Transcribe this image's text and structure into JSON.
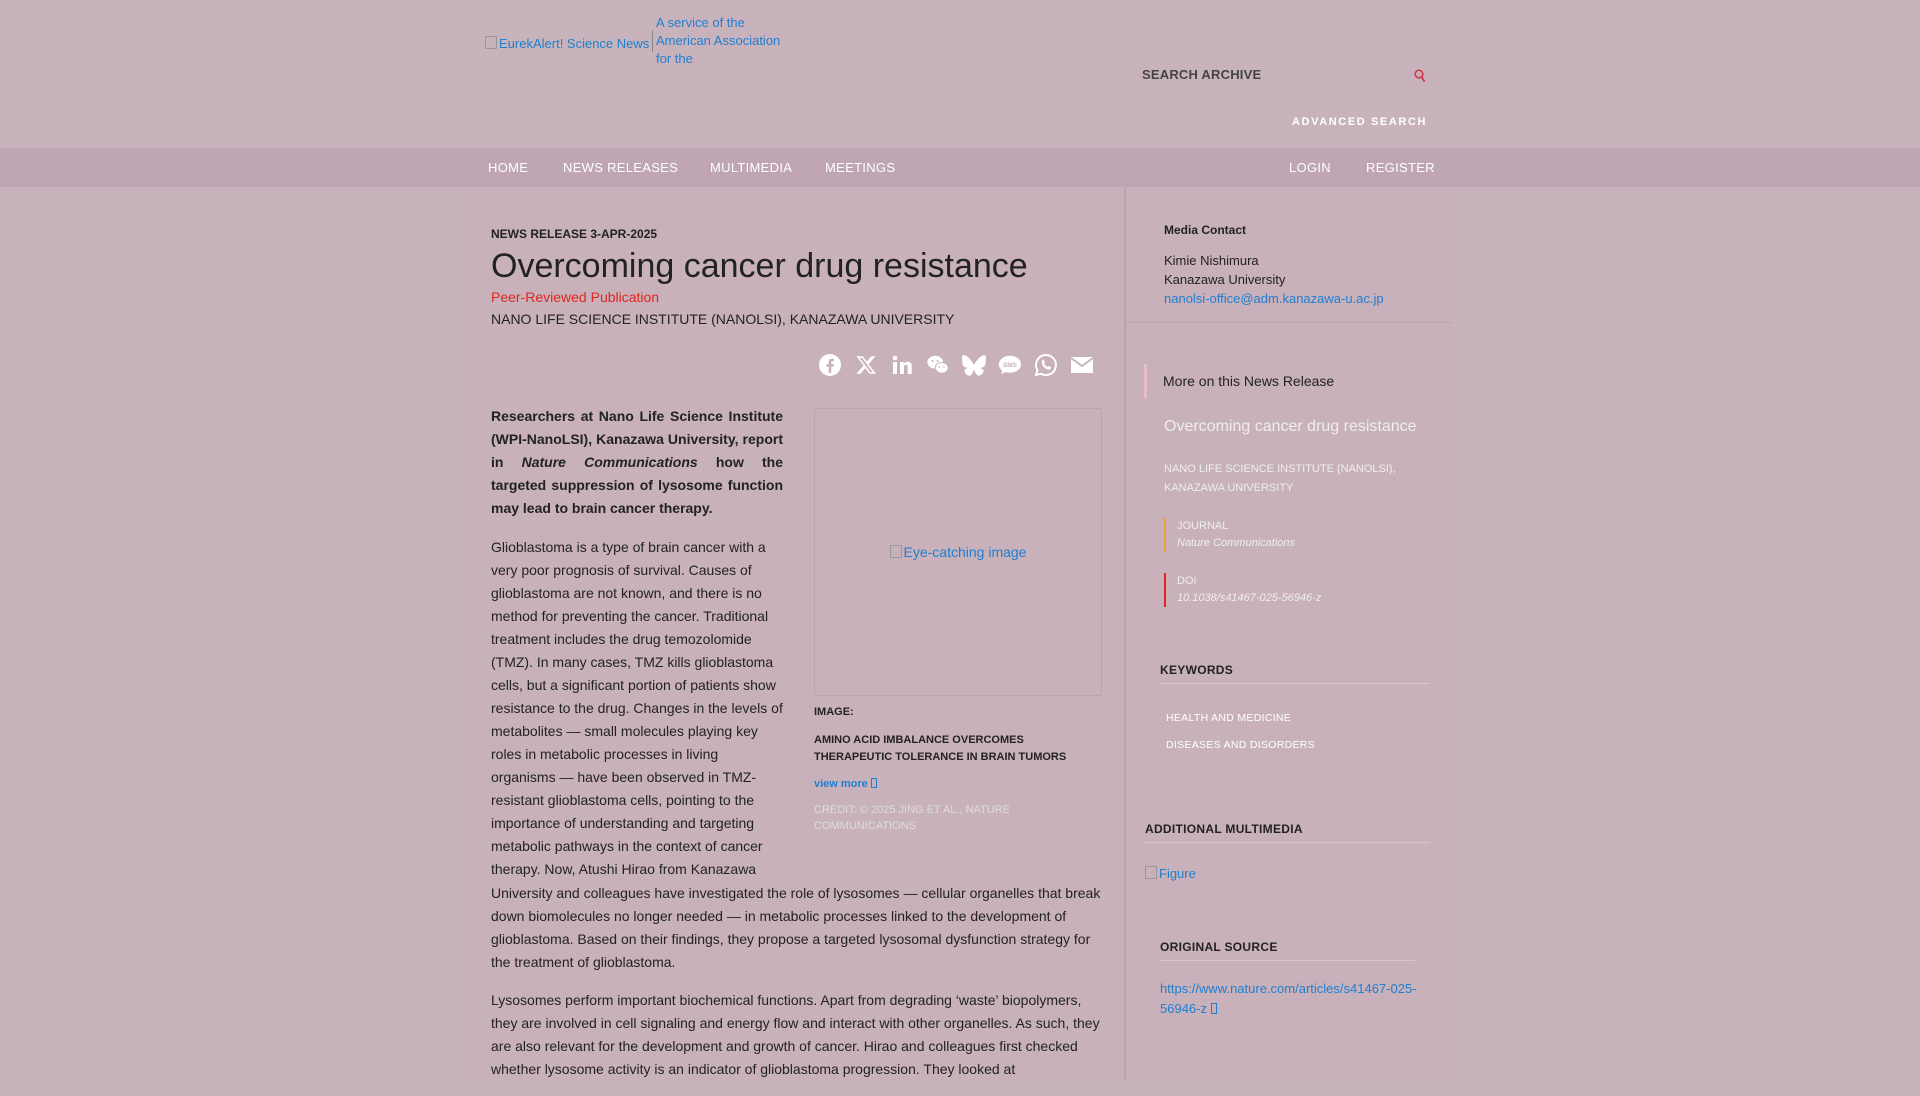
{
  "header": {
    "logo_alt": "EurekAlert! Science News",
    "aaas_alt": "A service of the American Association for the",
    "search_placeholder": "SEARCH ARCHIVE",
    "advanced_search": "ADVANCED SEARCH"
  },
  "nav": {
    "home": "HOME",
    "news_releases": "NEWS RELEASES",
    "multimedia": "MULTIMEDIA",
    "meetings": "MEETINGS",
    "login": "LOGIN",
    "register": "REGISTER"
  },
  "article": {
    "release_date": "NEWS RELEASE 3-APR-2025",
    "title": "Overcoming cancer drug resistance",
    "peer_reviewed": "Peer-Reviewed Publication",
    "institution": "NANO LIFE SCIENCE INSTITUTE (NANOLSI), KANAZAWA UNIVERSITY",
    "lead_part1": "Researchers at Nano Life Science Institute (WPI-NanoLSI), Kanazawa University, report in ",
    "lead_journal": "Nature Communications",
    "lead_part2": " how the targeted suppression of lysosome function may lead to brain cancer therapy.",
    "para1_narrow": "Glioblastoma is a type of brain cancer with a very poor prognosis of survival.  Causes of glioblastoma are not known, and there is no method for preventing the cancer.  Traditional treatment includes the drug temozolomide (TMZ).  In many cases, TMZ kills glioblastoma cells, but a significant portion of patients show resistance to the drug.  Changes in the levels of metabolites — small molecules playing key roles in metabolic processes in living organisms — have been observed in TMZ-resistant glioblastoma cells, pointing to the importance of understanding and targeting metabolic pathways in the context of cancer therapy.  Now, Atushi Hirao from Kanazawa",
    "para1_wide": "University and colleagues have investigated the role of lysosomes — cellular organelles that break down biomolecules no longer needed — in metabolic processes linked to the development of glioblastoma.  Based on their findings, they propose a targeted lysosomal dysfunction strategy for the treatment of glioblastoma.",
    "para2": "Lysosomes perform important biochemical functions.  Apart from degrading ‘waste’ biopolymers, they are involved in cell signaling and energy flow and interact with other organelles.  As such, they are also relevant for the development and growth of cancer.  Hirao and colleagues first checked whether lysosome activity is an indicator of glioblastoma progression.  They looked at"
  },
  "share": {
    "icons": [
      "facebook-icon",
      "x-icon",
      "linkedin-icon",
      "wechat-icon",
      "bluesky-icon",
      "sms-icon",
      "whatsapp-icon",
      "email-icon"
    ]
  },
  "image": {
    "alt": "Eye-catching image",
    "label": "IMAGE:",
    "caption": "AMINO ACID IMBALANCE OVERCOMES THERAPEUTIC TOLERANCE IN BRAIN TUMORS",
    "view_more": "view more ",
    "credit": "CREDIT: © 2025 JING ET AL., NATURE COMMUNICATIONS"
  },
  "sidebar": {
    "media_contact_title": "Media Contact",
    "contact_name": "Kimie Nishimura",
    "contact_org": "Kanazawa University",
    "contact_email": "nanolsi-office@adm.kanazawa-u.ac.jp",
    "more_on": "More on this News Release",
    "more_title": "Overcoming cancer drug resistance",
    "more_institution": "NANO LIFE SCIENCE INSTITUTE (NANOLSI), KANAZAWA UNIVERSITY",
    "journal_label": "JOURNAL",
    "journal_value": "Nature Communications",
    "doi_label": "DOI",
    "doi_value": "10.1038/s41467-025-56946-z",
    "keywords_title": "KEYWORDS",
    "keywords": [
      "HEALTH AND MEDICINE",
      "DISEASES AND DISORDERS"
    ],
    "additional_title": "ADDITIONAL MULTIMEDIA",
    "figure_alt": "Figure",
    "original_source_title": "ORIGINAL SOURCE",
    "original_source_url": "https://www.nature.com/articles/s41467-025-56946-z "
  },
  "colors": {
    "background": "#c8b3bd",
    "nav_bar": "#bfa6b2",
    "link": "#1f7fcf",
    "peer_reviewed": "#e0261c",
    "search_icon": "#d2374a"
  }
}
